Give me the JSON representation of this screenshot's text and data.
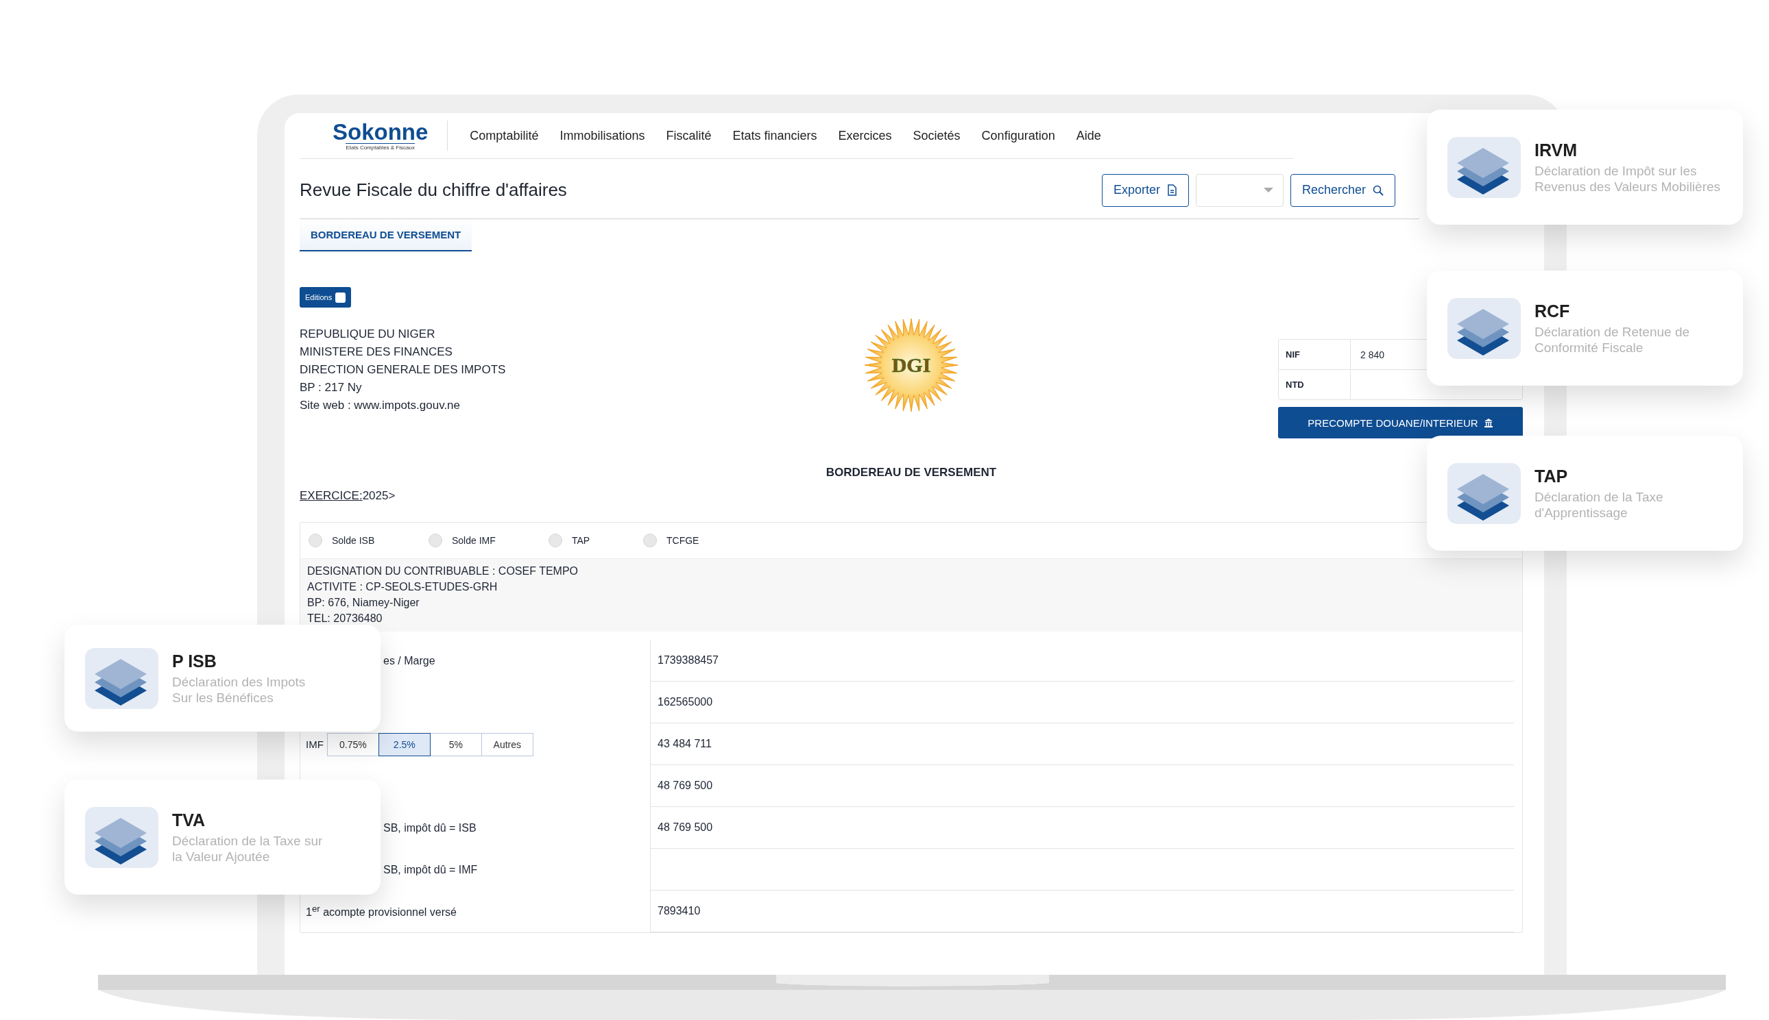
{
  "nav": {
    "logo": "Sokonne",
    "tagline": "Etats Comptables & Fiscaux",
    "items": [
      "Comptabilité",
      "Immobilisations",
      "Fiscalité",
      "Etats financiers",
      "Exercices",
      "Societés",
      "Configuration",
      "Aide"
    ]
  },
  "page_title": "Revue Fiscale du chiffre d'affaires",
  "toolbar": {
    "export": "Exporter",
    "search": "Rechercher"
  },
  "tabs": [
    {
      "label": "BORDEREAU DE VERSEMENT",
      "selected": true
    }
  ],
  "editions": {
    "label": "Editions",
    "checked": false
  },
  "issuer_lines": [
    "REPUBLIQUE DU NIGER",
    "MINISTERE DES FINANCES",
    "DIRECTION GENERALE DES IMPOTS",
    "BP : 217 Ny",
    "Site web : www.impots.gouv.ne"
  ],
  "emblem": {
    "text": "DGI"
  },
  "id_table": [
    {
      "label": "NIF",
      "value": "2 840"
    },
    {
      "label": "NTD"
    }
  ],
  "precompte_button": "PRECOMPTE DOUANE/INTERIEUR",
  "heading": "BORDEREAU DE VERSEMENT",
  "exercise": {
    "label": "EXERCICE:",
    "value": "2025>"
  },
  "options": [
    {
      "label": "Solde ISB",
      "selected": false
    },
    {
      "label": "Solde IMF",
      "selected": false
    },
    {
      "label": "TAP",
      "selected": false
    },
    {
      "label": "TCFGE",
      "selected": false
    }
  ],
  "taxpayer_lines": [
    "DESIGNATION DU CONTRIBUABLE : COSEF TEMPO",
    "ACTIVITE : CP-SEOLS-ETUDES-GRH",
    "BP: 676, Niamey-Niger",
    "TEL: 20736480"
  ],
  "rows": [
    {
      "kind": "text",
      "label": "es / Marge",
      "covered": true,
      "value": "1739388457"
    },
    {
      "kind": "text",
      "value": "162565000"
    },
    {
      "kind": "rates",
      "label": "IMF",
      "covered": false,
      "rates": [
        {
          "label": "0.75%",
          "selected": false
        },
        {
          "label": "2.5%",
          "selected": true
        },
        {
          "label": "5%",
          "selected": false
        },
        {
          "label": "Autres",
          "selected": false
        }
      ],
      "value": "43 484 711"
    },
    {
      "kind": "text",
      "value": "48 769 500"
    },
    {
      "kind": "text",
      "label": "SB, impôt dû = ISB",
      "covered": true,
      "value": "48 769 500"
    },
    {
      "kind": "text",
      "label": "SB, impôt dû = IMF",
      "covered": true
    },
    {
      "kind": "text",
      "label": "1$^{er}$ acompte provisionnel versé",
      "covered": false,
      "value": "7893410"
    }
  ],
  "feature_cards": [
    {
      "title": "IRVM",
      "description": "Déclaration de  Impôt sur les\nRevenus des Valeurs Mobilières"
    },
    {
      "title": "RCF",
      "description": "Déclaration de Retenue de\nConformité Fiscale"
    },
    {
      "title": "TAP",
      "description": "Déclaration de la Taxe\nd'Apprentissage"
    },
    {
      "title": "P ISB",
      "description": "Déclaration des Impots\nSur les Bénéfices"
    },
    {
      "title": "TVA",
      "description": "Déclaration de la Taxe sur\nla Valeur Ajoutée"
    }
  ]
}
